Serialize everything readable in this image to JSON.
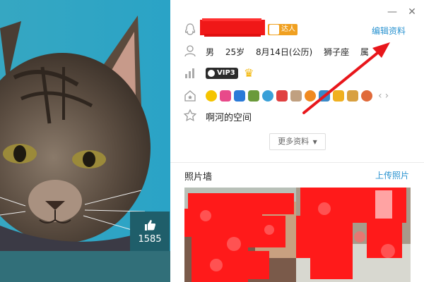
{
  "window": {
    "minimize_glyph": "—",
    "close_glyph": "✕"
  },
  "photo": {
    "like_count": "1585"
  },
  "profile": {
    "vip_badge_label": "达人",
    "edit_link": "编辑资料",
    "info": {
      "gender": "男",
      "age": "25岁",
      "birthday": "8月14日(公历)",
      "zodiac": "狮子座",
      "extra": "属"
    },
    "vip_level_label": "VIP3",
    "crown_glyph": "♛",
    "space_link": "啊河的空间",
    "more_button": "更多资料",
    "chev_left": "‹",
    "chev_right": "›"
  },
  "photo_wall": {
    "title": "照片墙",
    "upload_link": "上传照片"
  },
  "colors": {
    "accent": "#2a93d0",
    "annotation_red": "#e8161b",
    "panel_teal": "#316f79",
    "vip_orange": "#f0a020"
  },
  "icons": [
    "thumbs-up-icon",
    "qq-penguin-icon",
    "person-icon",
    "level-bars-icon",
    "medal-house-icon",
    "star-outline-icon",
    "minimize-icon",
    "close-icon"
  ]
}
